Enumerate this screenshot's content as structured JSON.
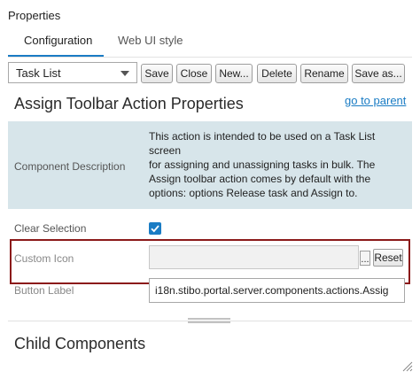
{
  "panel": {
    "title": "Properties"
  },
  "tabs": [
    {
      "label": "Configuration",
      "active": true
    },
    {
      "label": "Web UI style",
      "active": false
    }
  ],
  "toolbar": {
    "select_value": "Task List",
    "save": "Save",
    "close": "Close",
    "new": "New...",
    "delete": "Delete",
    "rename": "Rename",
    "save_as": "Save as..."
  },
  "header": {
    "title": "Assign Toolbar Action Properties",
    "go_to_parent": "go to parent"
  },
  "description": {
    "label": "Component Description",
    "lines": [
      "This action is intended to be used on a Task List",
      "screen",
      "for assigning and unassigning tasks in bulk. The",
      "Assign toolbar action comes by default with the",
      "options: options Release task and Assign to."
    ]
  },
  "fields": {
    "clear_selection": {
      "label": "Clear Selection",
      "checked": true
    },
    "custom_icon": {
      "label": "Custom Icon",
      "value": "",
      "browse": "...",
      "reset": "Reset"
    },
    "button_label": {
      "label": "Button Label",
      "value": "i18n.stibo.portal.server.components.actions.Assig"
    }
  },
  "child_components": {
    "title": "Child Components"
  },
  "colors": {
    "accent": "#1a7cc4",
    "description_bg": "#d7e5ea",
    "highlight_border": "#8b1a1a"
  }
}
